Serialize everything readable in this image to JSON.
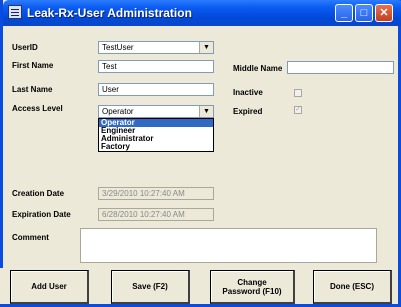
{
  "window": {
    "title": "Leak-Rx-User Administration"
  },
  "labels": {
    "userid": "UserID",
    "first_name": "First Name",
    "last_name": "Last Name",
    "access_level": "Access Level",
    "middle_name": "Middle Name",
    "inactive": "Inactive",
    "expired": "Expired",
    "creation_date": "Creation Date",
    "expiration_date": "Expiration Date",
    "comment": "Comment"
  },
  "fields": {
    "userid": "TestUser",
    "first_name": "Test",
    "last_name": "User",
    "access_level": "Operator",
    "middle_name": "",
    "creation_date": "3/29/2010 10:27:40 AM",
    "expiration_date": "6/28/2010 10:27:40 AM",
    "comment": ""
  },
  "access_level_options": [
    "Operator",
    "Engineer",
    "Administrator",
    "Factory"
  ],
  "access_level_selected_index": 0,
  "checkboxes": {
    "inactive": false,
    "expired": true
  },
  "buttons": {
    "add_user": "Add User",
    "save": "Save (F2)",
    "change_password_line1": "Change",
    "change_password_line2": "Password (F10)",
    "done": "Done (ESC)"
  }
}
